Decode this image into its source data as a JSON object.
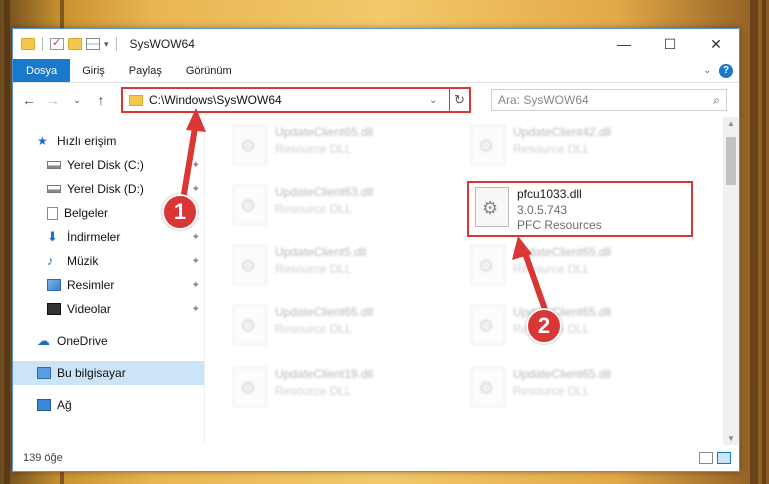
{
  "window": {
    "title": "SysWOW64"
  },
  "ribbon": {
    "tabs": [
      "Dosya",
      "Giriş",
      "Paylaş",
      "Görünüm"
    ]
  },
  "address": {
    "path": "C:\\Windows\\SysWOW64"
  },
  "search": {
    "placeholder": "Ara: SysWOW64"
  },
  "sidebar": {
    "quick_access": "Hızlı erişim",
    "items": [
      "Yerel Disk (C:)",
      "Yerel Disk (D:)",
      "Belgeler",
      "İndirmeler",
      "Müzik",
      "Resimler",
      "Videolar"
    ],
    "onedrive": "OneDrive",
    "this_pc": "Bu bilgisayar",
    "network": "Ağ"
  },
  "files": [
    {
      "name": "UpdateClient65.dll",
      "desc": "Resource DLL"
    },
    {
      "name": "UpdateClient42.dll",
      "desc": "Resource DLL"
    },
    {
      "name": "UpdateClient63.dll",
      "desc": "Resource DLL"
    },
    {
      "name": "pfcu1033.dll",
      "version": "3.0.5.743",
      "desc": "PFC Resources"
    },
    {
      "name": "UpdateClient5.dll",
      "desc": "Resource DLL"
    },
    {
      "name": "UpdateClient65.dll",
      "desc": "Resource DLL"
    },
    {
      "name": "UpdateClient65.dll",
      "desc": "Resource DLL"
    },
    {
      "name": "UpdateClient65.dll",
      "desc": "Resource DLL"
    },
    {
      "name": "UpdateClient19.dll",
      "desc": "Resource DLL"
    },
    {
      "name": "UpdateClient65.dll",
      "desc": "Resource DLL"
    }
  ],
  "status": {
    "count": "139 öğe"
  },
  "annotations": {
    "step1": "1",
    "step2": "2"
  },
  "colors": {
    "accent": "#1979ca",
    "highlight": "#d93636"
  }
}
